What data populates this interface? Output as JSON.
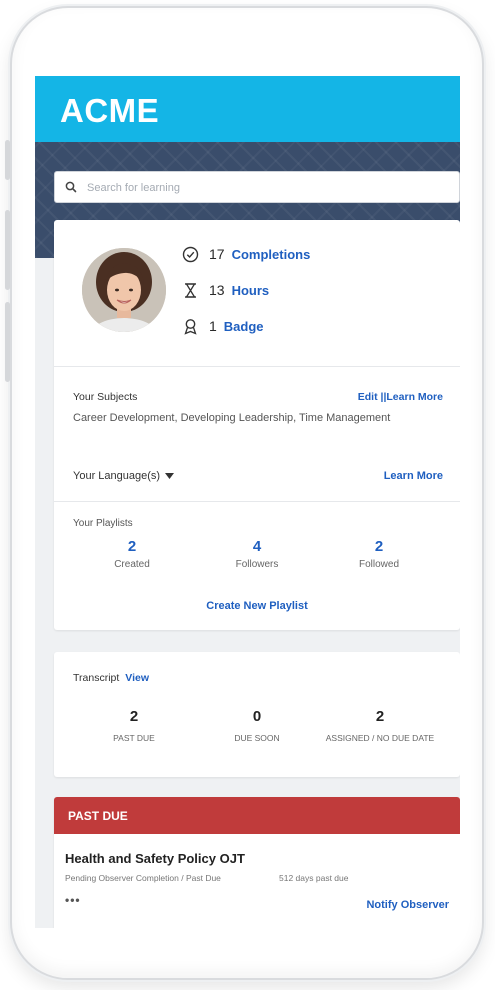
{
  "brand": {
    "logo": "ACME",
    "header_color": "#14b5e6"
  },
  "search": {
    "placeholder": "Search for learning"
  },
  "profile": {
    "stats": [
      {
        "icon": "check-circle-icon",
        "count": "17",
        "label": "Completions"
      },
      {
        "icon": "hourglass-icon",
        "count": "13",
        "label": "Hours"
      },
      {
        "icon": "badge-icon",
        "count": "1",
        "label": "Badge"
      }
    ]
  },
  "subjects": {
    "heading": "Your Subjects",
    "links": "Edit ||Learn More",
    "list": "Career Development, Developing Leadership, Time Management"
  },
  "language": {
    "label": "Your Language(s)",
    "learn_more": "Learn More"
  },
  "playlists": {
    "heading": "Your Playlists",
    "stats": [
      {
        "value": "2",
        "label": "Created"
      },
      {
        "value": "4",
        "label": "Followers"
      },
      {
        "value": "2",
        "label": "Followed"
      }
    ],
    "create_label": "Create New Playlist"
  },
  "transcript": {
    "heading": "Transcript",
    "view_label": "View",
    "stats": [
      {
        "value": "2",
        "label": "PAST DUE"
      },
      {
        "value": "0",
        "label": "DUE SOON"
      },
      {
        "value": "2",
        "label": "ASSIGNED / NO DUE DATE"
      }
    ]
  },
  "past_due": {
    "header": "PAST DUE",
    "header_color": "#c03b3b",
    "course_title": "Health and Safety Policy OJT",
    "status": "Pending Observer Completion / Past Due",
    "days": "512 days past due",
    "more": "•••",
    "notify_label": "Notify Observer"
  }
}
